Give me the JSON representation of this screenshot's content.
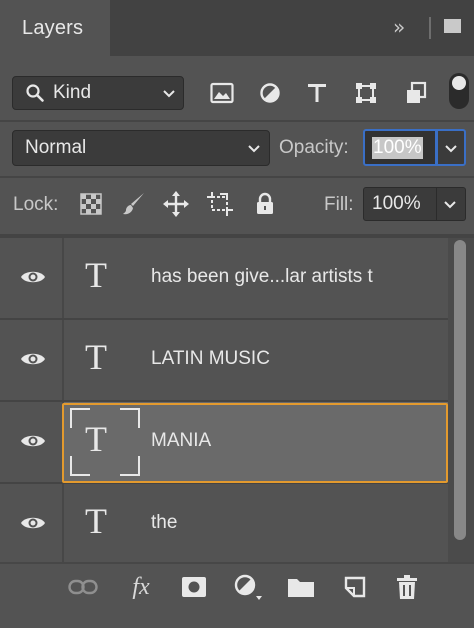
{
  "panel": {
    "tab_title": "Layers",
    "colors": {
      "background": "#535353",
      "header": "#424242",
      "selection_outline": "#e39a2e",
      "focus": "#3a6fc6"
    }
  },
  "filter": {
    "kind_label": "Kind",
    "icons": [
      "search-icon",
      "image-filter-icon",
      "adjustment-filter-icon",
      "type-filter-icon",
      "shape-filter-icon",
      "smart-object-filter-icon",
      "filter-toggle"
    ]
  },
  "blend": {
    "mode": "Normal",
    "opacity_label": "Opacity:",
    "opacity_value": "100%"
  },
  "lock": {
    "label": "Lock:",
    "fill_label": "Fill:",
    "fill_value": "100%",
    "icons": [
      "lock-transparent-pixels-icon",
      "lock-image-pixels-icon",
      "lock-position-icon",
      "lock-artboard-icon",
      "lock-all-icon"
    ]
  },
  "layers": [
    {
      "name": "has been give...lar artists t",
      "type": "text",
      "visible": true,
      "selected": false
    },
    {
      "name": "LATIN MUSIC",
      "type": "text",
      "visible": true,
      "selected": false
    },
    {
      "name": "MANIA",
      "type": "text",
      "visible": true,
      "selected": true
    },
    {
      "name": "the",
      "type": "text",
      "visible": true,
      "selected": false
    }
  ],
  "type_glyph": "T",
  "bottom_toolbar": {
    "fx_label": "fx",
    "icons": [
      "link-layers-icon",
      "fx-icon",
      "layer-mask-icon",
      "adjustment-layer-icon",
      "group-folder-icon",
      "new-layer-icon",
      "trash-icon"
    ]
  }
}
